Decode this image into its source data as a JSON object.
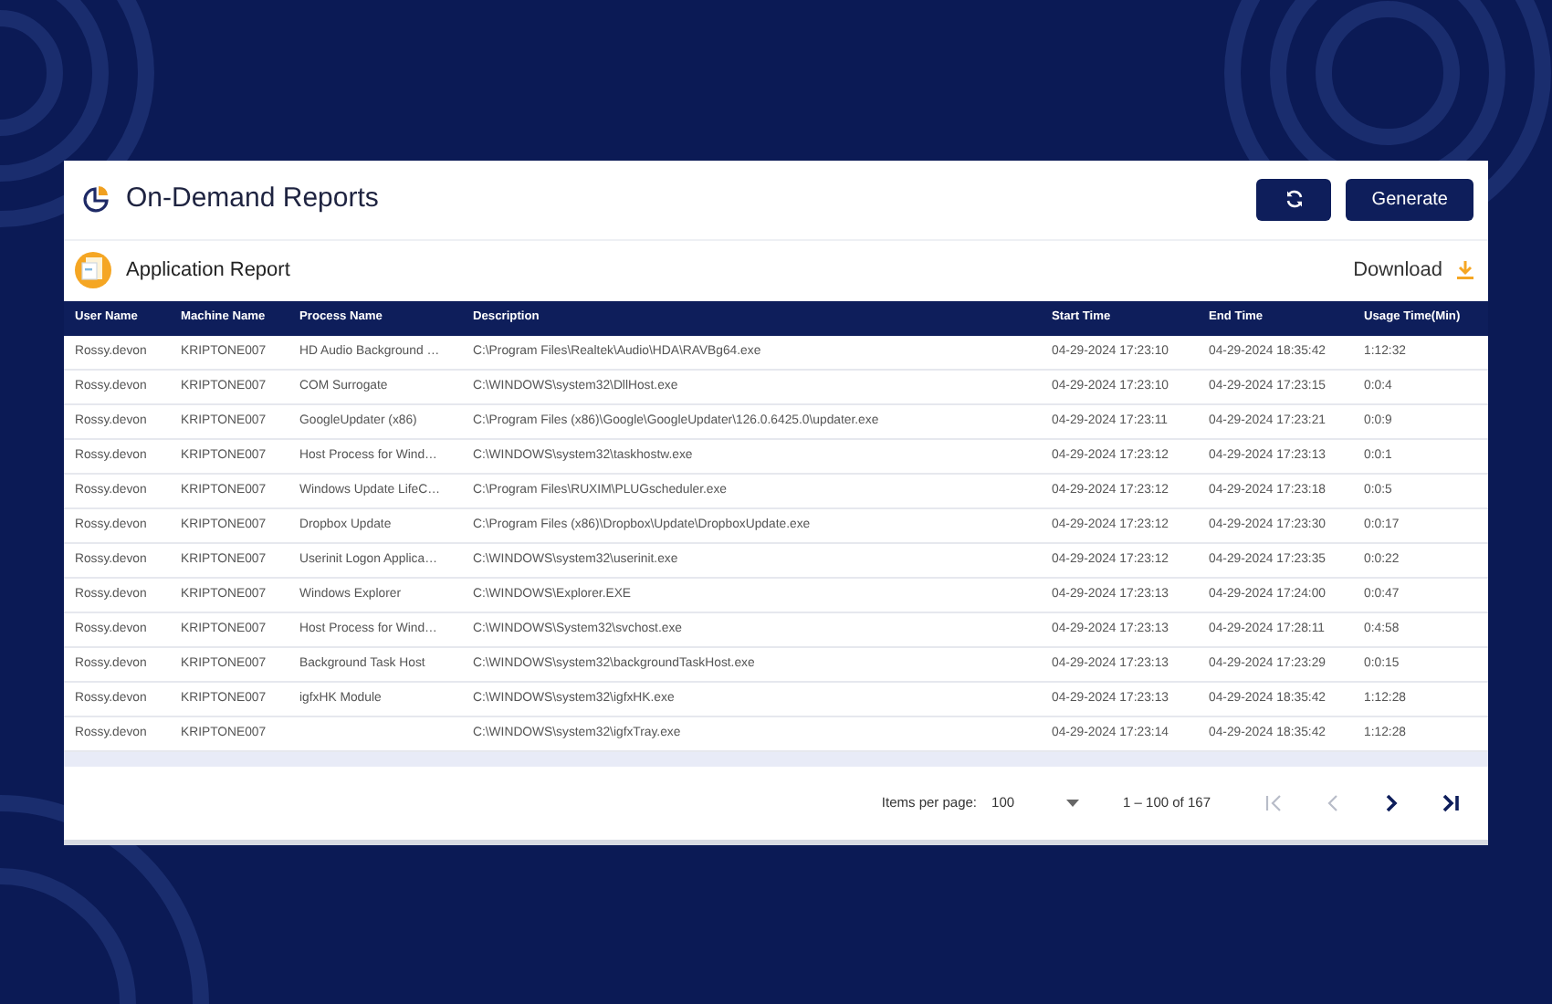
{
  "header": {
    "title": "On-Demand Reports",
    "buttons": [
      {
        "kind": "refresh"
      },
      {
        "kind": "text",
        "label": "Generate"
      }
    ]
  },
  "report": {
    "title": "Application Report",
    "download": "Download"
  },
  "table": {
    "columns": [
      "User Name",
      "Machine Name",
      "Process Name",
      "Description",
      "Start Time",
      "End Time",
      "Usage Time(Min)"
    ],
    "rows": [
      [
        "Rossy.devon",
        "KRIPTONE007",
        "HD Audio Background …",
        "C:\\Program Files\\Realtek\\Audio\\HDA\\RAVBg64.exe",
        "04-29-2024 17:23:10",
        "04-29-2024 18:35:42",
        "1:12:32"
      ],
      [
        "Rossy.devon",
        "KRIPTONE007",
        "COM Surrogate",
        "C:\\WINDOWS\\system32\\DllHost.exe",
        "04-29-2024 17:23:10",
        "04-29-2024 17:23:15",
        "0:0:4"
      ],
      [
        "Rossy.devon",
        "KRIPTONE007",
        "GoogleUpdater (x86)",
        "C:\\Program Files (x86)\\Google\\GoogleUpdater\\126.0.6425.0\\updater.exe",
        "04-29-2024 17:23:11",
        "04-29-2024 17:23:21",
        "0:0:9"
      ],
      [
        "Rossy.devon",
        "KRIPTONE007",
        "Host Process for Wind…",
        "C:\\WINDOWS\\system32\\taskhostw.exe",
        "04-29-2024 17:23:12",
        "04-29-2024 17:23:13",
        "0:0:1"
      ],
      [
        "Rossy.devon",
        "KRIPTONE007",
        "Windows Update LifeC…",
        "C:\\Program Files\\RUXIM\\PLUGscheduler.exe",
        "04-29-2024 17:23:12",
        "04-29-2024 17:23:18",
        "0:0:5"
      ],
      [
        "Rossy.devon",
        "KRIPTONE007",
        "Dropbox Update",
        "C:\\Program Files (x86)\\Dropbox\\Update\\DropboxUpdate.exe",
        "04-29-2024 17:23:12",
        "04-29-2024 17:23:30",
        "0:0:17"
      ],
      [
        "Rossy.devon",
        "KRIPTONE007",
        "Userinit Logon Applica…",
        "C:\\WINDOWS\\system32\\userinit.exe",
        "04-29-2024 17:23:12",
        "04-29-2024 17:23:35",
        "0:0:22"
      ],
      [
        "Rossy.devon",
        "KRIPTONE007",
        "Windows Explorer",
        "C:\\WINDOWS\\Explorer.EXE",
        "04-29-2024 17:23:13",
        "04-29-2024 17:24:00",
        "0:0:47"
      ],
      [
        "Rossy.devon",
        "KRIPTONE007",
        "Host Process for Wind…",
        "C:\\WINDOWS\\System32\\svchost.exe",
        "04-29-2024 17:23:13",
        "04-29-2024 17:28:11",
        "0:4:58"
      ],
      [
        "Rossy.devon",
        "KRIPTONE007",
        "Background Task Host",
        "C:\\WINDOWS\\system32\\backgroundTaskHost.exe",
        "04-29-2024 17:23:13",
        "04-29-2024 17:23:29",
        "0:0:15"
      ],
      [
        "Rossy.devon",
        "KRIPTONE007",
        "igfxHK Module",
        "C:\\WINDOWS\\system32\\igfxHK.exe",
        "04-29-2024 17:23:13",
        "04-29-2024 18:35:42",
        "1:12:28"
      ],
      [
        "Rossy.devon",
        "KRIPTONE007",
        "",
        "C:\\WINDOWS\\system32\\igfxTray.exe",
        "04-29-2024 17:23:14",
        "04-29-2024 18:35:42",
        "1:12:28"
      ]
    ]
  },
  "paginator": {
    "items_per_page_label": "Items per page:",
    "items_per_page": "100",
    "range": "1 – 100 of 167",
    "buttons": [
      {
        "kind": "first",
        "disabled": true
      },
      {
        "kind": "prev",
        "disabled": true
      },
      {
        "kind": "next",
        "disabled": false
      },
      {
        "kind": "last",
        "disabled": false
      }
    ]
  }
}
